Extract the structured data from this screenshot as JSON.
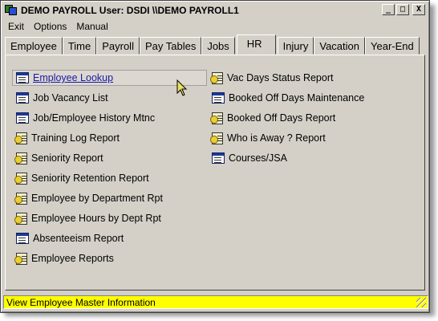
{
  "window": {
    "title": "DEMO PAYROLL  User: DSDI  \\\\DEMO PAYROLL1",
    "minimize_glyph": "_",
    "maximize_glyph": "□",
    "close_glyph": "X"
  },
  "menu": {
    "items": [
      "Exit",
      "Options",
      "Manual"
    ]
  },
  "tabs": {
    "items": [
      "Employee",
      "Time",
      "Payroll",
      "Pay Tables",
      "Jobs",
      "HR",
      "Injury",
      "Vacation",
      "Year-End"
    ],
    "active": "HR"
  },
  "hr_links": {
    "left": [
      {
        "label": "Employee Lookup",
        "icon": "screen-icon",
        "focused": true
      },
      {
        "label": "Job Vacancy List",
        "icon": "screen-icon"
      },
      {
        "label": "Job/Employee History Mtnc",
        "icon": "screen-icon"
      },
      {
        "label": "Training Log Report",
        "icon": "report-icon"
      },
      {
        "label": "Seniority Report",
        "icon": "report-icon"
      },
      {
        "label": "Seniority Retention Report",
        "icon": "report-icon"
      },
      {
        "label": "Employee by Department Rpt",
        "icon": "report-icon"
      },
      {
        "label": "Employee Hours by Dept Rpt",
        "icon": "report-icon"
      },
      {
        "label": "Absenteeism Report",
        "icon": "screen-icon"
      },
      {
        "label": "Employee Reports",
        "icon": "report-icon"
      }
    ],
    "right": [
      {
        "label": "Vac Days Status Report",
        "icon": "report-icon"
      },
      {
        "label": "Booked Off Days Maintenance",
        "icon": "screen-icon"
      },
      {
        "label": "Booked Off Days Report",
        "icon": "report-icon"
      },
      {
        "label": "Who is Away ? Report",
        "icon": "report-icon"
      },
      {
        "label": "Courses/JSA",
        "icon": "screen-icon"
      }
    ]
  },
  "status": {
    "text": "View Employee Master Information",
    "color": "#ffff00"
  }
}
